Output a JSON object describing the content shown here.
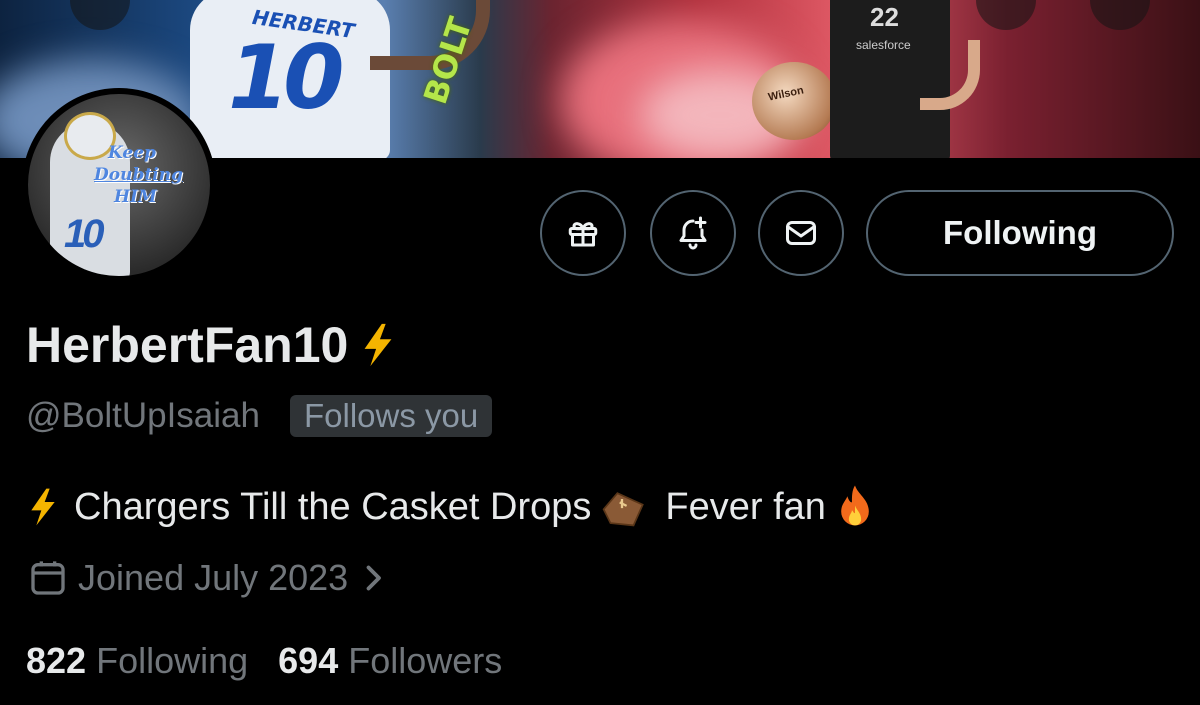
{
  "banner": {
    "jersey_name": "HERBERT",
    "jersey_number": "10",
    "side_text": "BOLT",
    "player2_number": "22",
    "player2_sponsor": "salesforce",
    "ball_brand": "Wilson"
  },
  "avatar": {
    "number": "10",
    "line1": "Keep",
    "line2": "Doubting",
    "line3": "HIM"
  },
  "actions": {
    "gift_icon": "gift-icon",
    "notify_icon": "bell-plus-icon",
    "message_icon": "envelope-icon",
    "follow_label": "Following"
  },
  "profile": {
    "display_name": "HerbertFan10",
    "name_emoji": "lightning-bolt",
    "handle": "@BoltUpIsaiah",
    "follows_you": "Follows you",
    "bio_part1": "Chargers Till the Casket Drops",
    "bio_part2": "Fever fan",
    "joined": "Joined July 2023",
    "following_count": "822",
    "following_label": "Following",
    "followers_count": "694",
    "followers_label": "Followers"
  },
  "colors": {
    "background": "#000000",
    "text": "#e7e9ea",
    "muted": "#71767b",
    "border": "#536471",
    "bolt": "#f4b400"
  }
}
